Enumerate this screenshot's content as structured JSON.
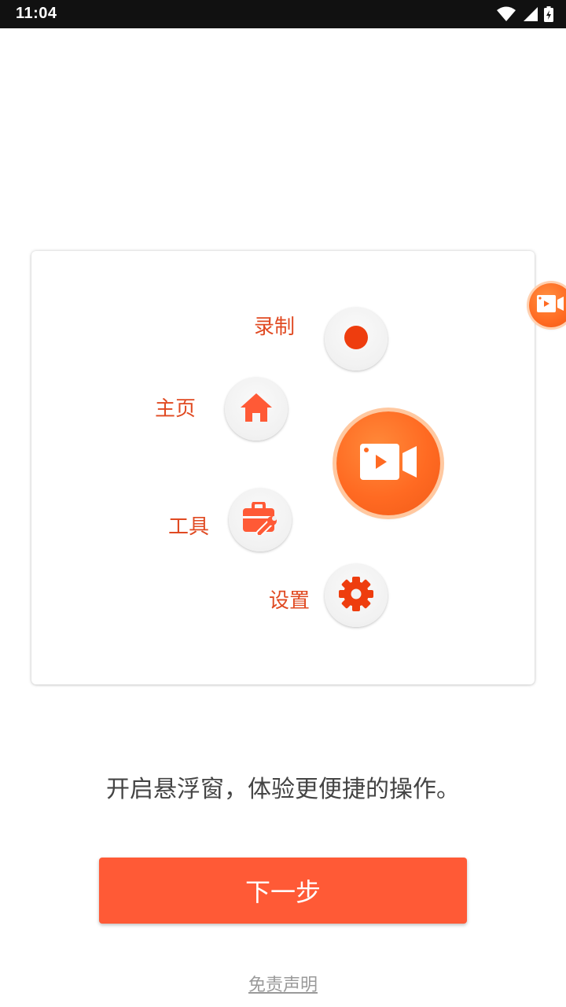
{
  "status_bar": {
    "time": "11:04",
    "icons": [
      "wifi-icon",
      "signal-icon",
      "battery-icon"
    ]
  },
  "float_menu": {
    "items": [
      {
        "label": "录制",
        "icon": "record-icon"
      },
      {
        "label": "主页",
        "icon": "home-icon"
      },
      {
        "label": "工具",
        "icon": "toolbox-icon"
      },
      {
        "label": "设置",
        "icon": "gear-icon"
      }
    ],
    "main_icon": "video-camera-icon"
  },
  "description": "开启悬浮窗，体验更便捷的操作。",
  "next_button": {
    "label": "下一步"
  },
  "disclaimer": {
    "label": "免责声明"
  },
  "colors": {
    "accent": "#ff5a36",
    "label": "#e04a22",
    "orange": "#ff6a22"
  }
}
